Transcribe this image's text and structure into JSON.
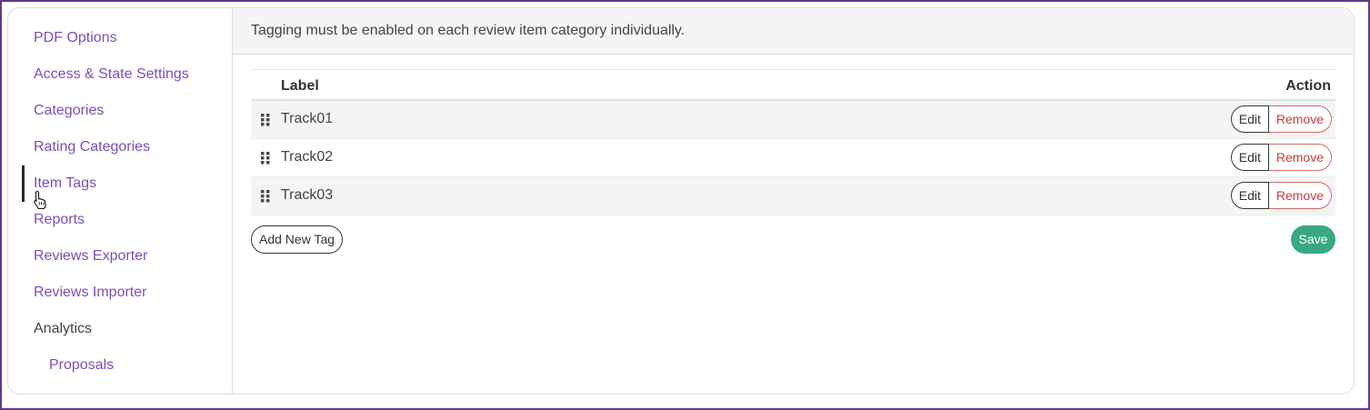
{
  "sidebar": {
    "items": [
      {
        "label": "PDF Options"
      },
      {
        "label": "Access & State Settings"
      },
      {
        "label": "Categories"
      },
      {
        "label": "Rating Categories"
      },
      {
        "label": "Item Tags"
      },
      {
        "label": "Reports"
      },
      {
        "label": "Reviews Exporter"
      },
      {
        "label": "Reviews Importer"
      },
      {
        "label": "Analytics"
      },
      {
        "label": "Proposals"
      }
    ],
    "active_item": "Item Tags"
  },
  "main": {
    "info_text": "Tagging must be enabled on each review item category individually.",
    "table": {
      "columns": {
        "label": "Label",
        "action": "Action"
      },
      "rows": [
        {
          "label": "Track01",
          "edit": "Edit",
          "remove": "Remove"
        },
        {
          "label": "Track02",
          "edit": "Edit",
          "remove": "Remove"
        },
        {
          "label": "Track03",
          "edit": "Edit",
          "remove": "Remove"
        }
      ]
    },
    "add_button": "Add New Tag",
    "save_button": "Save"
  },
  "colors": {
    "link": "#7a4fb8",
    "save": "#3aa983",
    "remove": "#c9403a",
    "frame": "#5e3a86"
  },
  "icons": [
    "drag-handle-icon",
    "hand-cursor-icon"
  ]
}
